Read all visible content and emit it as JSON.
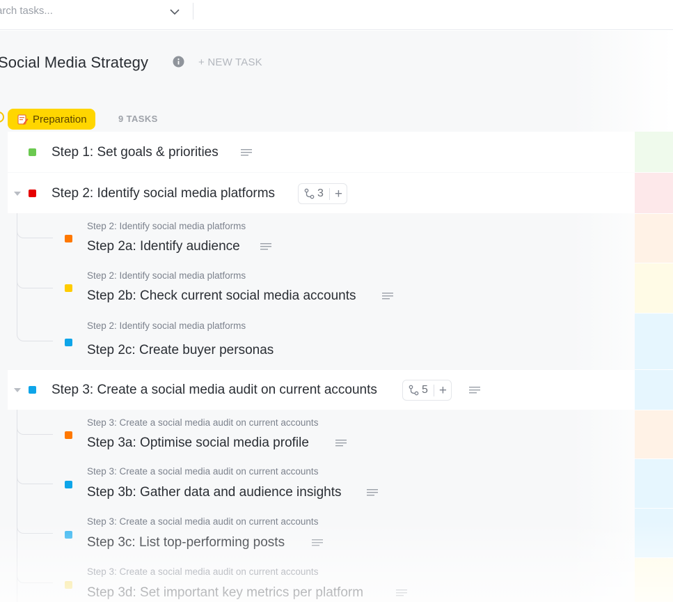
{
  "search": {
    "placeholder": "arch tasks..."
  },
  "list": {
    "title": "Social Media Strategy",
    "new_task_label": "+ NEW TASK"
  },
  "group": {
    "name": "Preparation",
    "task_count": "9 TASKS",
    "color": "#ffd600"
  },
  "tasks": [
    {
      "name": "Step 1: Set goals & priorities",
      "color": "#6bc950"
    },
    {
      "name": "Step 2: Identify social media platforms",
      "color": "#e50000",
      "subtask_count": "3",
      "add_label": "+",
      "subtasks": [
        {
          "parent": "Step 2: Identify social media platforms",
          "name": "Step 2a: Identify audience",
          "color": "#ff7800"
        },
        {
          "parent": "Step 2: Identify social media platforms",
          "name": "Step 2b: Check current social media accounts",
          "color": "#ffcc00"
        },
        {
          "parent": "Step 2: Identify social media platforms",
          "name": "Step 2c: Create buyer personas",
          "color": "#0ea5e9"
        }
      ]
    },
    {
      "name": "Step 3: Create a social media audit on current accounts",
      "color": "#0ea5e9",
      "subtask_count": "5",
      "add_label": "+",
      "subtasks": [
        {
          "parent": "Step 3: Create a social media audit on current accounts",
          "name": "Step 3a: Optimise social media profile",
          "color": "#ff7800"
        },
        {
          "parent": "Step 3: Create a social media audit on current accounts",
          "name": "Step 3b: Gather data and audience insights",
          "color": "#0ea5e9"
        },
        {
          "parent": "Step 3: Create a social media audit on current accounts",
          "name": "Step 3c: List top-performing posts",
          "color": "#3fb8f0"
        },
        {
          "parent": "Step 3: Create a social media audit on current accounts",
          "name": "Step 3d: Set important key metrics per platform",
          "color": "#f5dc6a"
        }
      ]
    }
  ],
  "icons": {
    "search_dropdown": "chevron-down-icon",
    "info": "info-icon",
    "group": "memo-icon",
    "description": "description-lines-icon",
    "subtasks": "subtask-branch-icon",
    "expand": "caret-down-icon"
  },
  "colors": {
    "strip_step1": "#effaec",
    "strip_step2": "#fde8ea",
    "strip_orange": "#fff2e6",
    "strip_yellow": "#fffbe6",
    "strip_blue": "#e6f6fe"
  }
}
